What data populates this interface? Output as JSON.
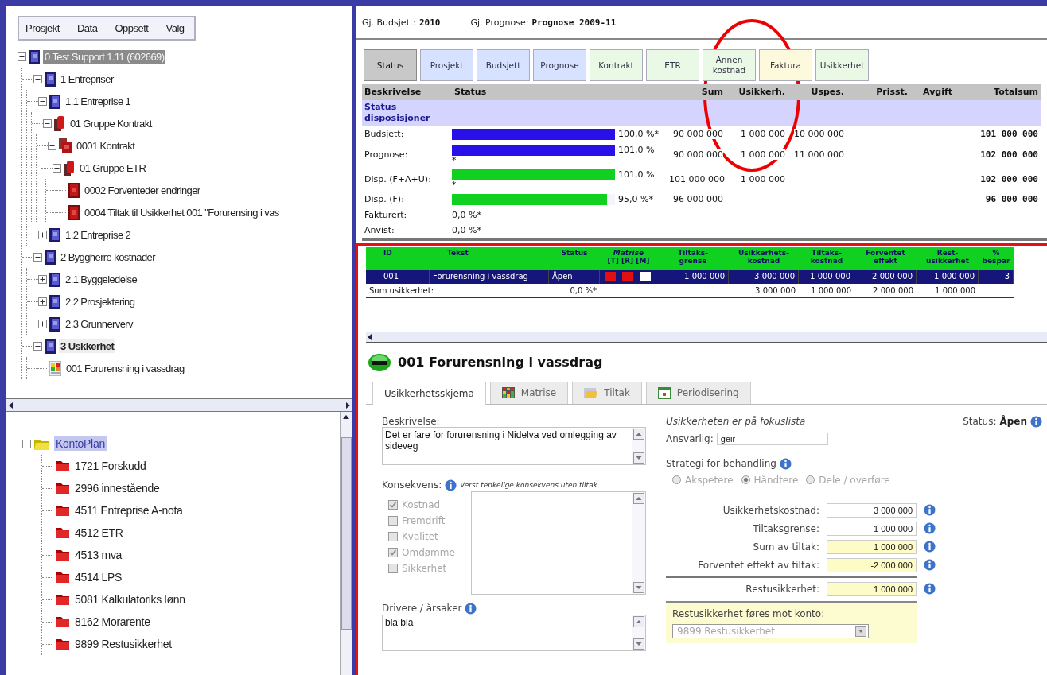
{
  "menu": [
    "Prosjekt",
    "Data",
    "Oppsett",
    "Valg"
  ],
  "project_tree": [
    {
      "label": "0 Test Support 1.11 (602669)",
      "kind": "project",
      "expanded": true,
      "selected": true,
      "current": false,
      "children": [
        {
          "label": "1 Entrepriser",
          "kind": "project",
          "expanded": true,
          "selected": false,
          "current": false,
          "children": [
            {
              "label": "1.1 Entreprise 1",
              "kind": "project",
              "expanded": true,
              "selected": false,
              "current": false,
              "children": [
                {
                  "label": "01 Gruppe Kontrakt",
                  "kind": "group",
                  "expanded": true,
                  "selected": false,
                  "current": false,
                  "children": [
                    {
                      "label": "0001 Kontrakt",
                      "kind": "contract",
                      "expanded": true,
                      "selected": false,
                      "current": false,
                      "children": [
                        {
                          "label": "01 Gruppe ETR",
                          "kind": "group",
                          "expanded": true,
                          "selected": false,
                          "current": false,
                          "children": [
                            {
                              "label": "0002 Forventeder endringer",
                              "kind": "item",
                              "selected": false,
                              "current": false
                            },
                            {
                              "label": "0004 Tiltak til Usikkerhet 001 \"Forurensing i vas",
                              "kind": "item",
                              "selected": false,
                              "current": false
                            }
                          ]
                        }
                      ]
                    }
                  ]
                }
              ]
            },
            {
              "label": "1.2 Entreprise 2",
              "kind": "project",
              "expanded": false,
              "selected": false,
              "current": false
            }
          ]
        },
        {
          "label": "2 Byggherre kostnader",
          "kind": "project",
          "expanded": true,
          "selected": false,
          "current": false,
          "children": [
            {
              "label": "2.1 Byggeledelse",
              "kind": "project",
              "expanded": false,
              "selected": false,
              "current": false
            },
            {
              "label": "2.2 Prosjektering",
              "kind": "project",
              "expanded": false,
              "selected": false,
              "current": false
            },
            {
              "label": "2.3 Grunnerverv",
              "kind": "project",
              "expanded": false,
              "selected": false,
              "current": false
            }
          ]
        },
        {
          "label": "3 Uskkerhet",
          "kind": "project",
          "expanded": true,
          "selected": false,
          "current": true,
          "children": [
            {
              "label": "001 Forurensning i vassdrag",
              "kind": "risk",
              "selected": false,
              "current": false
            }
          ]
        }
      ]
    }
  ],
  "accounts": {
    "label": "KontoPlan",
    "expanded": true,
    "selected": true,
    "children": [
      {
        "label": "1721 Forskudd",
        "selected": false
      },
      {
        "label": "2996 innestående",
        "selected": false
      },
      {
        "label": "4511 Entreprise A-nota",
        "selected": false
      },
      {
        "label": "4512 ETR",
        "selected": false
      },
      {
        "label": "4513 mva",
        "selected": false
      },
      {
        "label": "4514 LPS",
        "selected": false
      },
      {
        "label": "5081 Kalkulatoriks lønn",
        "selected": false
      },
      {
        "label": "8162 Morarente",
        "selected": false
      },
      {
        "label": "9899 Restusikkerhet",
        "selected": false
      }
    ]
  },
  "header": [
    {
      "label": "Gj. Budsjett:",
      "value": "2010"
    },
    {
      "label": "Gj. Prognose:",
      "value": "Prognose 2009-11"
    }
  ],
  "tabs": [
    {
      "label": "Status",
      "color": "#c8c8c8",
      "selected": true
    },
    {
      "label": "Prosjekt",
      "color": "#d6e2ff",
      "selected": false
    },
    {
      "label": "Budsjett",
      "color": "#d6e2ff",
      "selected": false
    },
    {
      "label": "Prognose",
      "color": "#d6e2ff",
      "selected": false
    },
    {
      "label": "Kontrakt",
      "color": "#eaf8e6",
      "selected": false
    },
    {
      "label": "ETR",
      "color": "#eaf8e6",
      "selected": false
    },
    {
      "label": "Annen\nkostnad",
      "color": "#eaf8e6",
      "selected": false
    },
    {
      "label": "Faktura",
      "color": "#fdf9dc",
      "selected": false
    },
    {
      "label": "Usikkerhet",
      "color": "#eaf8e6",
      "selected": false
    }
  ],
  "status_columns": [
    "Beskrivelse",
    "Status",
    "Sum",
    "Usikkerh.",
    "Uspes.",
    "Prisst.",
    "Avgift",
    "Totalsum"
  ],
  "status_section": "Status\ndisposisjoner",
  "status_rows": [
    {
      "label": "Budsjett:",
      "level": 1.0,
      "color": "#2a10e8",
      "percent": "100,0 %*",
      "sum": "90 000 000",
      "usikkerh": "1 000 000",
      "uspes": "10 000 000",
      "total": "101 000 000"
    },
    {
      "label": "Prognose:",
      "level": 1.0,
      "color": "#2a10e8",
      "percent": "101,0 %",
      "note": "*",
      "sum": "90 000 000",
      "usikkerh": "1 000 000",
      "uspes": "11 000 000",
      "total": "102 000 000"
    },
    {
      "label": "Disp. (F+A+U):",
      "level": 1.0,
      "color": "#10d020",
      "percent": "101,0 %",
      "note": "*",
      "sum": "101 000 000",
      "usikkerh": "1 000 000",
      "total": "102 000 000"
    },
    {
      "label": "Disp. (F):",
      "level": 0.95,
      "color": "#10d020",
      "percent": "95,0 %*",
      "sum": "96 000 000",
      "total": "96 000 000"
    },
    {
      "label": "Fakturert:",
      "percent": "0,0 %*"
    },
    {
      "label": "Anvist:",
      "percent": "0,0 %*"
    }
  ],
  "risk_columns": [
    {
      "label": "ID"
    },
    {
      "label": "Tekst"
    },
    {
      "label": "Status"
    },
    {
      "label": "Matrise",
      "sub": "[T]  [R]  [M]"
    },
    {
      "label": "Tiltaks-\ngrense"
    },
    {
      "label": "Usikkerhets-\nkostnad"
    },
    {
      "label": "Tiltaks-\nkostnad"
    },
    {
      "label": "Forventet\neffekt"
    },
    {
      "label": "Rest-\nusikkerhet"
    },
    {
      "label": "%\nbespar"
    }
  ],
  "risks": [
    {
      "selected": true,
      "id": "001",
      "text": "Forurensning i vassdrag",
      "status": "Åpen",
      "matrix": [
        {
          "color": "#e01010"
        },
        {
          "color": "#e01010"
        },
        {
          "color": "#ffffff"
        }
      ],
      "tiltaksgrense": "1 000 000",
      "usikkerhetskostnad": "3 000 000",
      "tiltakskostnad": "1 000 000",
      "forventet_effekt": "2 000 000",
      "restusikkerhet": "1 000 000",
      "besparelse": "3"
    }
  ],
  "risk_sum": {
    "label": "Sum usikkerhet:",
    "percent": "0,0 %*",
    "usikkerhetskostnad": "3 000 000",
    "tiltakskostnad": "1 000 000",
    "forventet_effekt": "2 000 000",
    "restusikkerhet": "1 000 000"
  },
  "risk_form": {
    "title": "001 Forurensning i vassdrag",
    "tabs": [
      {
        "label": "Usikkerhetsskjema",
        "kind": "plain",
        "selected": true
      },
      {
        "label": "Matrise",
        "kind": "matrix",
        "selected": false
      },
      {
        "label": "Tiltak",
        "kind": "folder",
        "selected": false
      },
      {
        "label": "Periodisering",
        "kind": "calendar",
        "selected": false
      }
    ],
    "description": {
      "label": "Beskrivelse:",
      "value": "Det er fare for forurensning i Nidelva ved omlegging av sideveg"
    },
    "consequence": {
      "label": "Konsekvens:",
      "hint": "Verst tenkelige konsekvens uten tiltak",
      "options": [
        {
          "label": "Kostnad",
          "checked": true,
          "disabled": true
        },
        {
          "label": "Fremdrift",
          "checked": false,
          "disabled": true
        },
        {
          "label": "Kvalitet",
          "checked": false,
          "disabled": true
        },
        {
          "label": "Omdømme",
          "checked": true,
          "disabled": true
        },
        {
          "label": "Sikkerhet",
          "checked": false,
          "disabled": true
        }
      ]
    },
    "drivers": {
      "label": "Drivere / årsaker",
      "value": "bla bla"
    },
    "focus_note": "Usikkerheten er på fokuslista",
    "status": {
      "label": "Status:",
      "value": "Åpen"
    },
    "responsible": {
      "label": "Ansvarlig:",
      "value": "geir"
    },
    "strategy": {
      "label": "Strategi for behandling",
      "options": [
        {
          "label": "Akspetere",
          "selected": false,
          "disabled": true
        },
        {
          "label": "Håndtere",
          "selected": true,
          "disabled": true
        },
        {
          "label": "Dele / overføre",
          "selected": false,
          "disabled": true
        }
      ]
    },
    "amounts": [
      {
        "label": "Usikkerhetskostnad:",
        "value": "3 000 000",
        "kind": "input"
      },
      {
        "label": "Tiltaksgrense:",
        "value": "1 000 000",
        "kind": "input"
      },
      {
        "label": "Sum av tiltak:",
        "value": "1 000 000",
        "kind": "computed"
      },
      {
        "label": "Forventet effekt av tiltak:",
        "value": "-2 000 000",
        "kind": "computed"
      },
      {
        "label": "Restusikkerhet:",
        "value": "1 000 000",
        "kind": "total"
      }
    ],
    "account": {
      "label": "Restusikkerhet føres mot konto:",
      "value": "9899 Restusikkerhet",
      "disabled": true
    }
  }
}
